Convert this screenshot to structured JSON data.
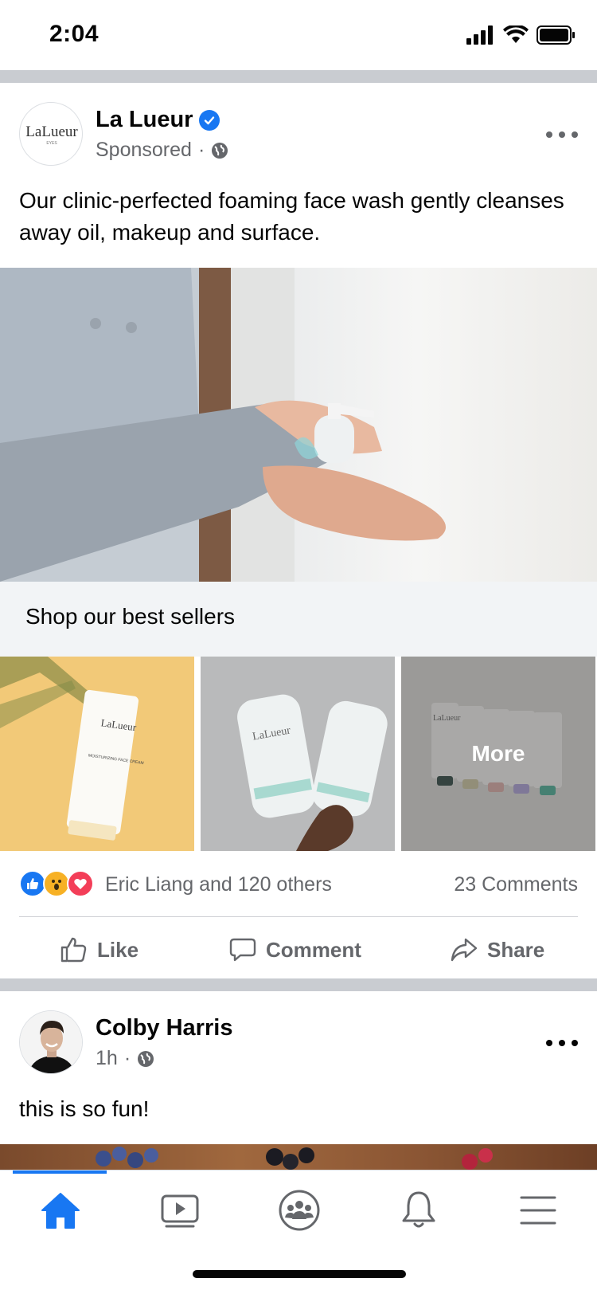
{
  "status_bar": {
    "time": "2:04"
  },
  "post1": {
    "author": "La Lueur",
    "avatar_logo_text": "LaLueur",
    "avatar_logo_subtext": "EYES",
    "meta": "Sponsored",
    "text": "Our clinic-perfected foaming face wash gently cleanses away oil, makeup and surface.",
    "shop_title": "Shop our best sellers",
    "products": [
      {
        "brand": "LaLueur",
        "subtitle": "MOISTURIZING FACE CREAM"
      },
      {
        "brand": "LaLueur",
        "subtitle": ""
      },
      {
        "brand": "LaLueur",
        "subtitle": ""
      }
    ],
    "more_label": "More",
    "reactions_text": "Eric Liang and 120 others",
    "comments_count": "23 Comments",
    "actions": {
      "like": "Like",
      "comment": "Comment",
      "share": "Share"
    }
  },
  "post2": {
    "author": "Colby Harris",
    "meta": "1h",
    "text": "this is so fun!"
  },
  "tabs": [
    "home-icon",
    "video-icon",
    "groups-icon",
    "bell-icon",
    "menu-icon"
  ],
  "colors": {
    "accent": "#1877f2",
    "secondary_text": "#65676b",
    "love": "#f33e58",
    "wow": "#f7b125"
  }
}
